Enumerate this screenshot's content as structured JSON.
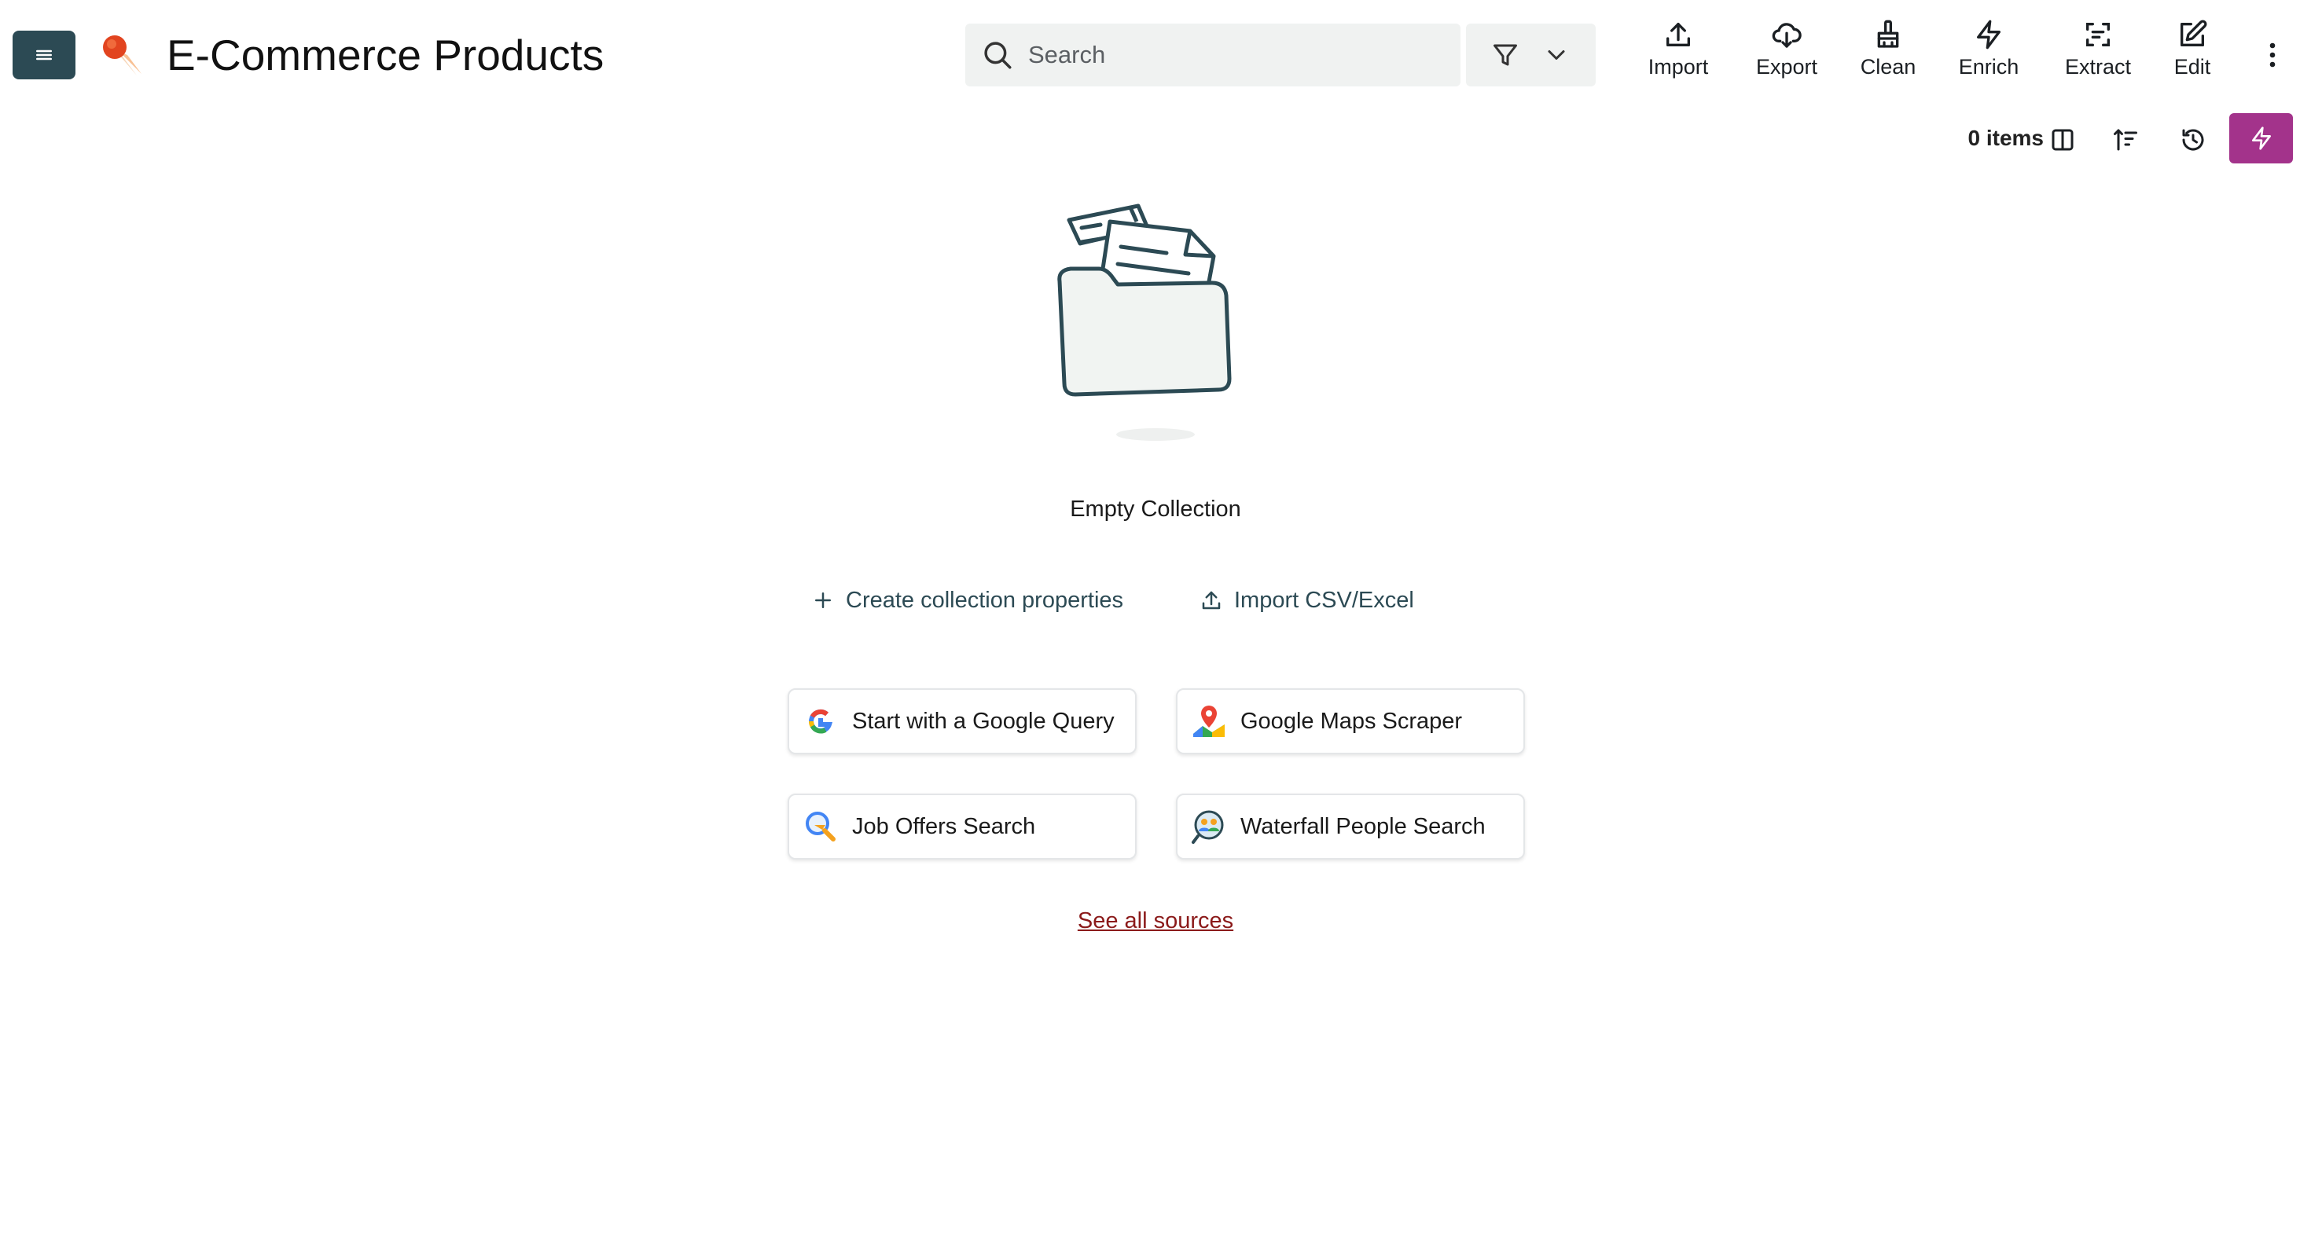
{
  "header": {
    "title": "E-Commerce Products",
    "menu_icon": "hamburger-icon",
    "logo_icon": "rocket-logo-icon"
  },
  "search": {
    "placeholder": "Search",
    "value": ""
  },
  "toolbar": {
    "import_label": "Import",
    "export_label": "Export",
    "clean_label": "Clean",
    "enrich_label": "Enrich",
    "extract_label": "Extract",
    "edit_label": "Edit"
  },
  "subbar": {
    "items_count": "0 items"
  },
  "empty_state": {
    "title": "Empty Collection",
    "create_properties_label": "Create collection properties",
    "import_csv_label": "Import CSV/Excel"
  },
  "sources": [
    {
      "label": "Start with a Google Query",
      "icon": "google-icon"
    },
    {
      "label": "Google Maps Scraper",
      "icon": "google-maps-icon"
    },
    {
      "label": "Job Offers Search",
      "icon": "job-search-icon"
    },
    {
      "label": "Waterfall People Search",
      "icon": "people-search-icon"
    }
  ],
  "see_all_sources": "See all sources",
  "colors": {
    "menu_button": "#2c4a54",
    "bolt_button": "#a3338b",
    "see_all_link": "#8b1a1a",
    "search_background": "#f0f2f1"
  }
}
